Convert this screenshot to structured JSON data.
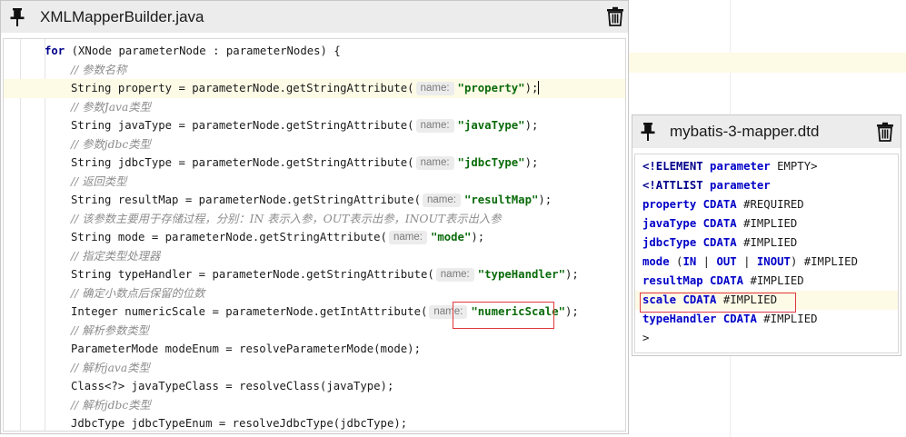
{
  "left_tab": {
    "title": "XMLMapperBuilder.java",
    "pin_icon": "pin-icon",
    "close_icon": "trash-icon"
  },
  "code": [
    {
      "kind": "for",
      "kw": "for",
      "text": " (XNode parameterNode : parameterNodes) {"
    },
    {
      "kind": "comment",
      "text": "// 参数名称"
    },
    {
      "kind": "call",
      "before": "String property = parameterNode.getStringAttribute(",
      "hint": "name:",
      "arg": "\"property\"",
      "after": ");",
      "current": true
    },
    {
      "kind": "comment",
      "text": "// 参数Java类型"
    },
    {
      "kind": "call",
      "before": "String javaType = parameterNode.getStringAttribute(",
      "hint": "name:",
      "arg": "\"javaType\"",
      "after": ");"
    },
    {
      "kind": "comment",
      "text": "// 参数jdbc类型"
    },
    {
      "kind": "call",
      "before": "String jdbcType = parameterNode.getStringAttribute(",
      "hint": "name:",
      "arg": "\"jdbcType\"",
      "after": ");"
    },
    {
      "kind": "comment",
      "text": "// 返回类型"
    },
    {
      "kind": "call",
      "before": "String resultMap = parameterNode.getStringAttribute(",
      "hint": "name:",
      "arg": "\"resultMap\"",
      "after": ");"
    },
    {
      "kind": "comment",
      "text": "// 该参数主要用于存储过程，分别：IN 表示入参，OUT表示出参，INOUT表示出入参"
    },
    {
      "kind": "call",
      "before": "String mode = parameterNode.getStringAttribute(",
      "hint": "name:",
      "arg": "\"mode\"",
      "after": ");"
    },
    {
      "kind": "comment",
      "text": "// 指定类型处理器"
    },
    {
      "kind": "call",
      "before": "String typeHandler = parameterNode.getStringAttribute(",
      "hint": "name:",
      "arg": "\"typeHandler\"",
      "after": ");"
    },
    {
      "kind": "comment",
      "text": "// 确定小数点后保留的位数"
    },
    {
      "kind": "call",
      "before": "Integer numericScale = parameterNode.getIntAttribute(",
      "hint": "name:",
      "arg": "\"numericScale\"",
      "after": ");",
      "boxed": true
    },
    {
      "kind": "comment",
      "text": "// 解析参数类型"
    },
    {
      "kind": "plain",
      "text": "ParameterMode modeEnum = resolveParameterMode(mode);"
    },
    {
      "kind": "comment",
      "text": "// 解析java类型"
    },
    {
      "kind": "plain",
      "text": "Class<?> javaTypeClass = resolveClass(javaType);"
    },
    {
      "kind": "comment",
      "text": "// 解析jdbc类型"
    },
    {
      "kind": "plain",
      "text": "JdbcType jdbcTypeEnum = resolveJdbcType(jdbcType);"
    }
  ],
  "right_tab": {
    "title": "mybatis-3-mapper.dtd",
    "pin_icon": "pin-icon",
    "close_icon": "trash-icon"
  },
  "dtd": [
    {
      "parts": [
        [
          "kw",
          "<!ELEMENT"
        ],
        [
          "t",
          " "
        ],
        [
          "attr",
          "parameter"
        ],
        [
          "t",
          " EMPTY>"
        ]
      ]
    },
    {
      "parts": [
        [
          "kw",
          "<!ATTLIST"
        ],
        [
          "t",
          " "
        ],
        [
          "attr",
          "parameter"
        ]
      ]
    },
    {
      "parts": [
        [
          "attr",
          "property"
        ],
        [
          "t",
          " "
        ],
        [
          "attr",
          "CDATA"
        ],
        [
          "t",
          " #REQUIRED"
        ]
      ]
    },
    {
      "parts": [
        [
          "attr",
          "javaType"
        ],
        [
          "t",
          " "
        ],
        [
          "attr",
          "CDATA"
        ],
        [
          "t",
          " #IMPLIED"
        ]
      ]
    },
    {
      "parts": [
        [
          "attr",
          "jdbcType"
        ],
        [
          "t",
          " "
        ],
        [
          "attr",
          "CDATA"
        ],
        [
          "t",
          " #IMPLIED"
        ]
      ]
    },
    {
      "parts": [
        [
          "attr",
          "mode"
        ],
        [
          "t",
          " ("
        ],
        [
          "attr",
          "IN"
        ],
        [
          "t",
          " | "
        ],
        [
          "attr",
          "OUT"
        ],
        [
          "t",
          " | "
        ],
        [
          "attr",
          "INOUT"
        ],
        [
          "t",
          ") #IMPLIED"
        ]
      ]
    },
    {
      "parts": [
        [
          "attr",
          "resultMap"
        ],
        [
          "t",
          " "
        ],
        [
          "attr",
          "CDATA"
        ],
        [
          "t",
          " #IMPLIED"
        ]
      ]
    },
    {
      "parts": [
        [
          "attr",
          "scale"
        ],
        [
          "t",
          " "
        ],
        [
          "attr",
          "CDATA"
        ],
        [
          "t",
          " #IMPLIED"
        ]
      ],
      "current": true,
      "boxed": true
    },
    {
      "parts": [
        [
          "attr",
          "typeHandler"
        ],
        [
          "t",
          " "
        ],
        [
          "attr",
          "CDATA"
        ],
        [
          "t",
          " #IMPLIED"
        ]
      ]
    },
    {
      "parts": [
        [
          "t",
          ">"
        ]
      ]
    }
  ],
  "colors": {
    "highlight_box": "#e0383e",
    "current_line": "#fdfae6",
    "keyword": "#00008b",
    "string": "#0a6b0a"
  }
}
